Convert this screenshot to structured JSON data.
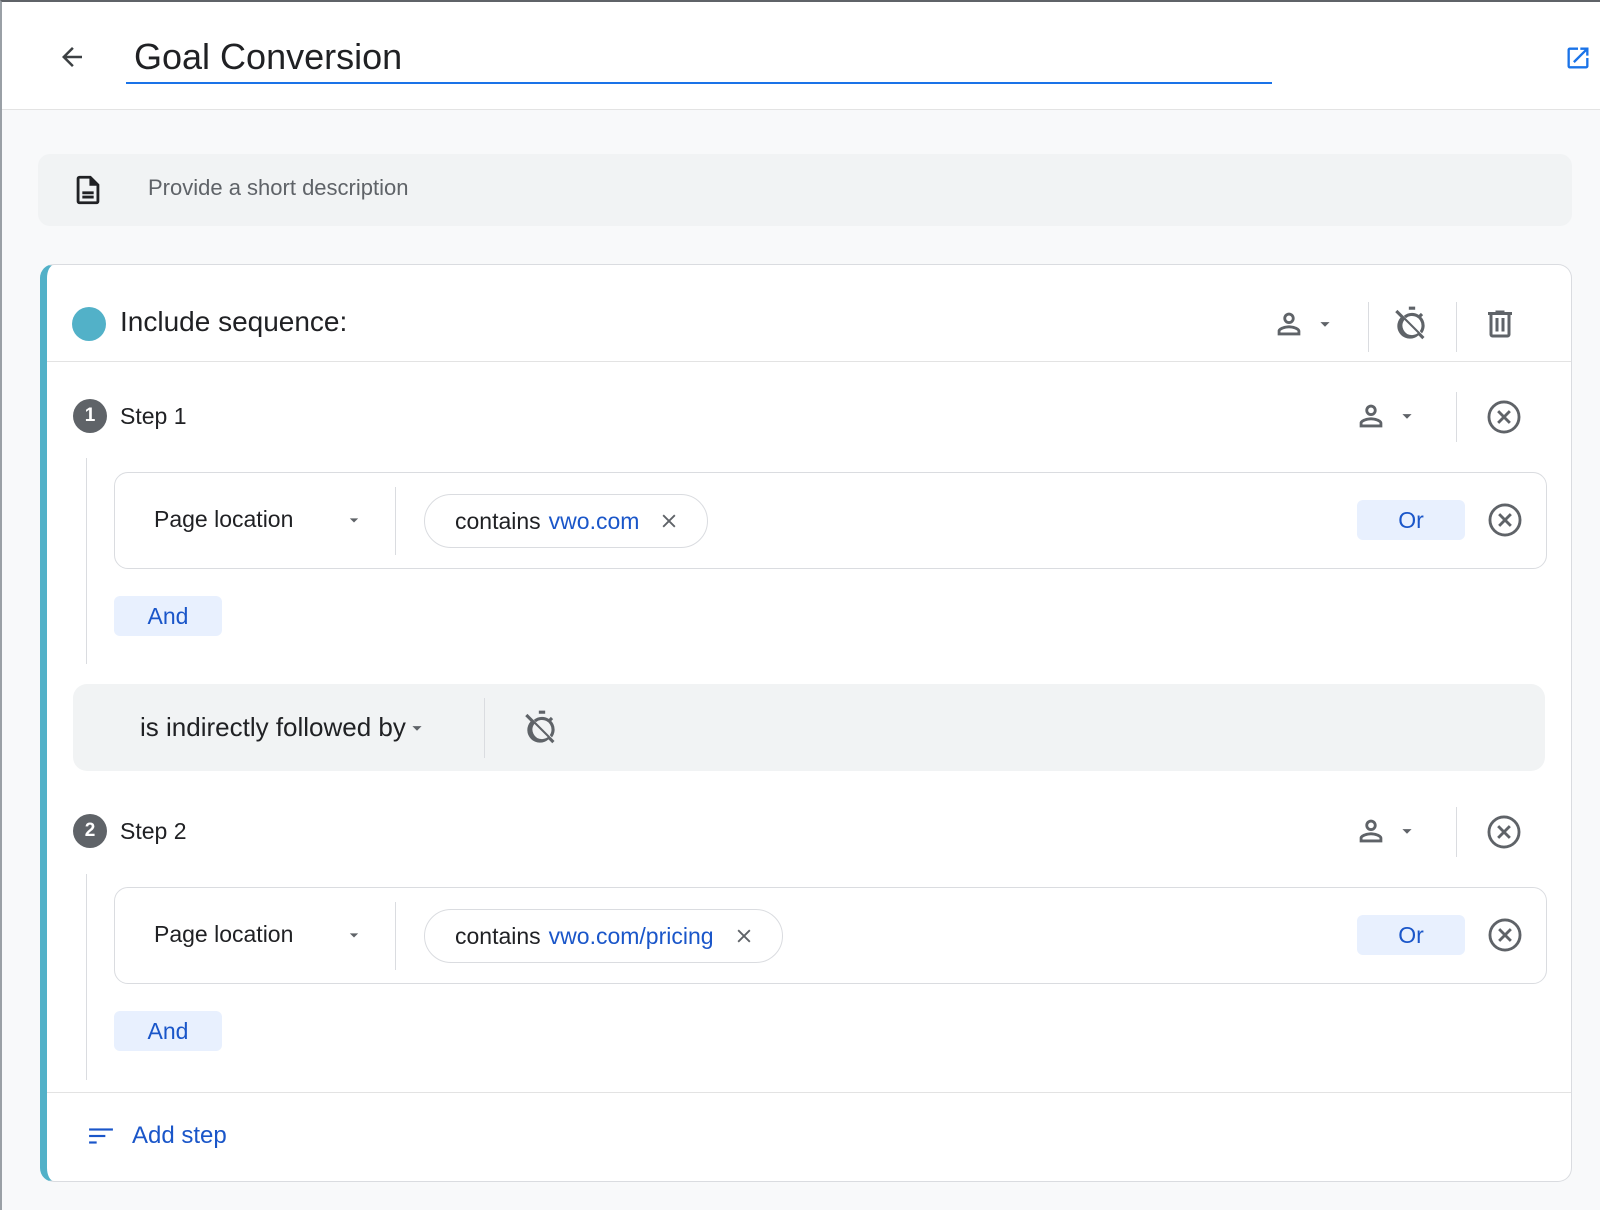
{
  "header": {
    "title_value": "Goal Conversion",
    "back_icon": "arrow-back-icon",
    "external_icon": "open-in-new-icon"
  },
  "description": {
    "placeholder": "Provide a short description",
    "value": "",
    "icon": "document-icon"
  },
  "sequence": {
    "label": "Include sequence:",
    "accent_color": "#52b1c8",
    "scope_icon": "person-icon",
    "timer_icon": "timer-off-icon",
    "delete_icon": "trash-icon",
    "steps": [
      {
        "number": "1",
        "label": "Step 1",
        "dimension": "Page location",
        "operator": "contains",
        "value": "vwo.com",
        "or_label": "Or",
        "and_label": "And"
      },
      {
        "number": "2",
        "label": "Step 2",
        "dimension": "Page location",
        "operator": "contains",
        "value": "vwo.com/pricing",
        "or_label": "Or",
        "and_label": "And"
      }
    ],
    "follow": {
      "label": "is indirectly followed by"
    },
    "add_step_label": "Add step"
  },
  "colors": {
    "primary_blue": "#1a73e8",
    "link_blue": "#1a56c9",
    "chip_bg": "#e8f0fe",
    "icon_gray": "#5f6368"
  }
}
